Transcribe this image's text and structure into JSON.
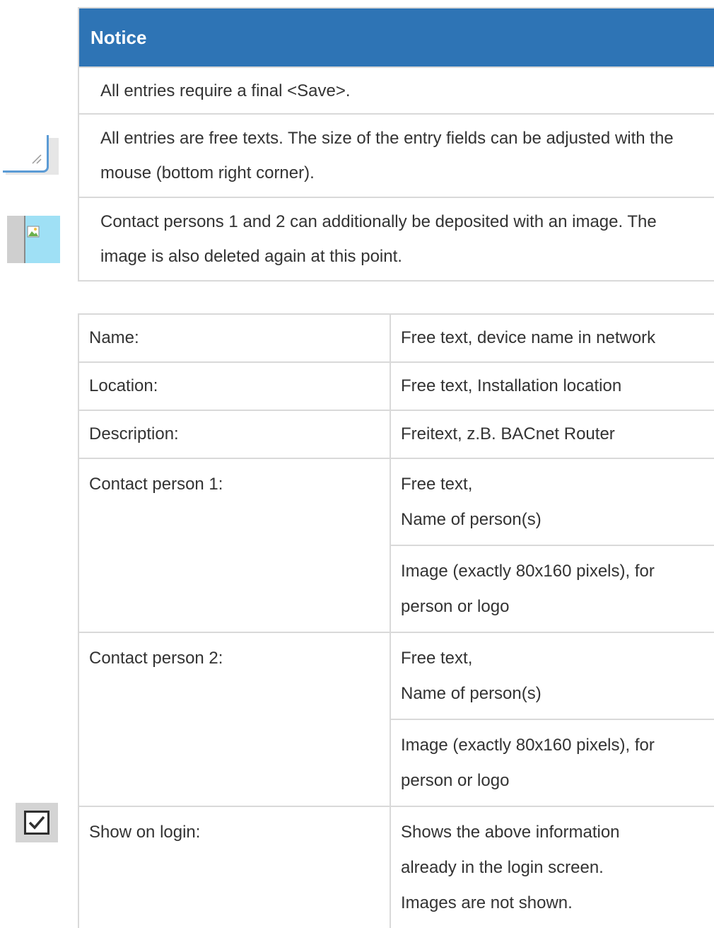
{
  "notice": {
    "title": "Notice",
    "items": [
      "All entries require a final <Save>.",
      "All entries are free texts. The size of the entry fields can be adjusted with the mouse (bottom right corner).",
      "Contact persons 1 and 2 can additionally be deposited with an image. The image is also deleted again at this point."
    ],
    "icons": [
      "resize-handle-icon",
      "image-placeholder-icon"
    ]
  },
  "table": {
    "rows": [
      {
        "label": "Name:",
        "description": [
          "Free text, device name in network"
        ]
      },
      {
        "label": "Location:",
        "description": [
          "Free text, Installation location"
        ]
      },
      {
        "label": "Description:",
        "description": [
          "Freitext, z.B. BACnet Router"
        ]
      },
      {
        "label": "Contact person 1:",
        "description": [
          "Free text,",
          "Name of person(s)"
        ]
      },
      {
        "label": "",
        "description": [
          "Image (exactly 80x160 pixels), for",
          "person or logo"
        ]
      },
      {
        "label": "Contact person 2:",
        "description": [
          "Free text,",
          "Name of person(s)"
        ]
      },
      {
        "label": "",
        "description": [
          "Image (exactly 80x160 pixels), for",
          "person or logo"
        ]
      },
      {
        "label": "Show on login:",
        "description": [
          "Shows the above information",
          "already in the login screen.",
          "Images are not shown."
        ]
      }
    ],
    "icons": [
      "checkbox-checked-icon"
    ]
  },
  "colors": {
    "header_bg": "#2e74b5",
    "border": "#d9d9d9",
    "text": "#333333"
  }
}
